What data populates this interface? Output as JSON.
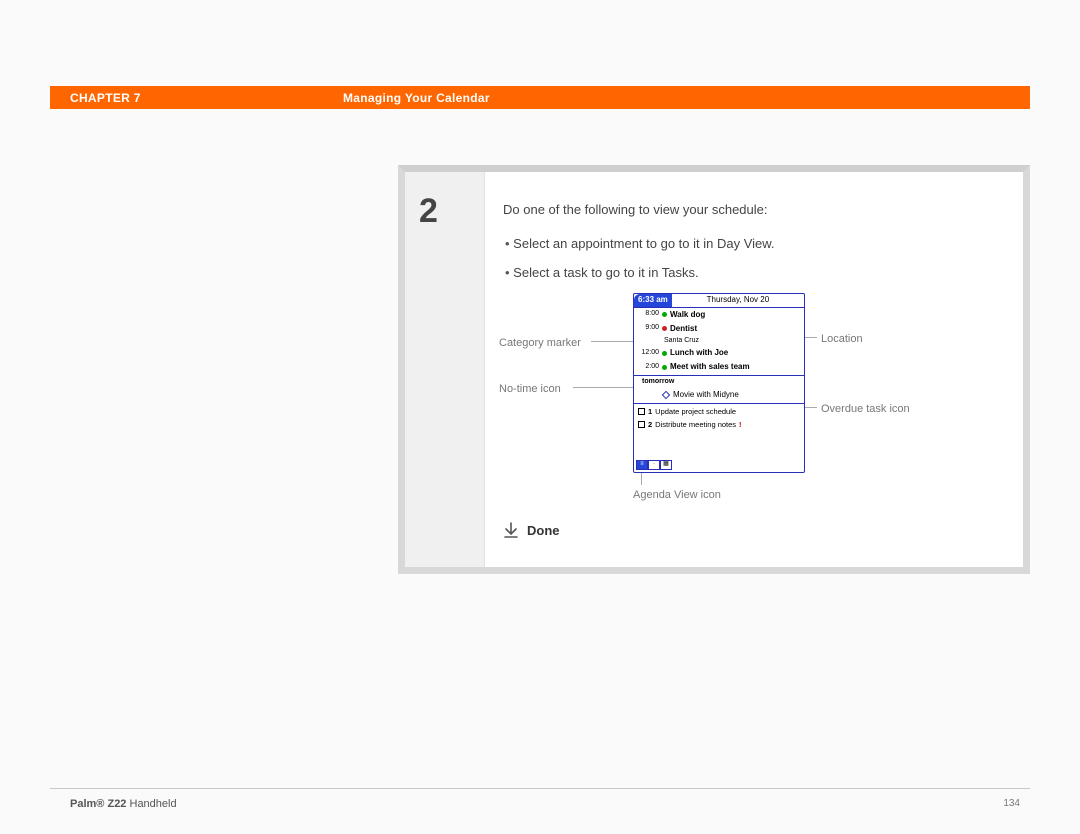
{
  "header": {
    "chapter": "CHAPTER 7",
    "title": "Managing Your Calendar"
  },
  "step": {
    "number": "2",
    "instruction": "Do one of the following to view your schedule:",
    "bullets": [
      "Select an appointment to go to it in Day View.",
      "Select a task to go to it in Tasks."
    ],
    "done": "Done"
  },
  "callouts": {
    "category_marker": "Category marker",
    "no_time_icon": "No-time icon",
    "location": "Location",
    "overdue_task_icon": "Overdue task icon",
    "agenda_view_icon": "Agenda View icon"
  },
  "pda": {
    "time": "6:33 am",
    "date": "Thursday, Nov 20",
    "events": [
      {
        "t": "8:00",
        "dot": "g",
        "title": "Walk dog"
      },
      {
        "t": "9:00",
        "dot": "r",
        "title": "Dentist",
        "sub": "Santa Cruz"
      },
      {
        "t": "12:00",
        "dot": "g",
        "title": "Lunch with Joe"
      },
      {
        "t": "2:00",
        "dot": "g",
        "title": "Meet with sales team"
      }
    ],
    "tomorrow_label": "tomorrow",
    "notime": {
      "title": "Movie with Midyne"
    },
    "tasks": [
      {
        "n": "1",
        "title": "Update project schedule"
      },
      {
        "n": "2",
        "title": "Distribute meeting notes",
        "overdue": true
      }
    ]
  },
  "footer": {
    "brand": "Palm®",
    "model": "Z22",
    "suffix": "Handheld",
    "page": "134"
  }
}
